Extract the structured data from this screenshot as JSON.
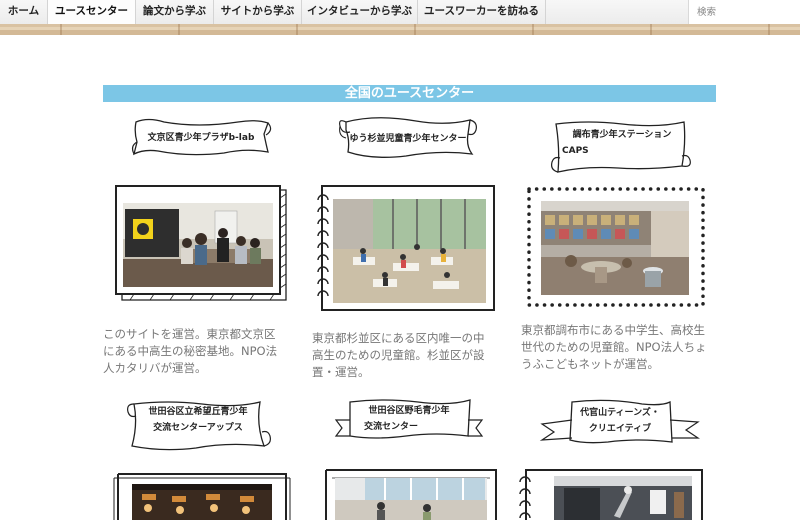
{
  "nav": {
    "items": [
      {
        "label": "ホーム"
      },
      {
        "label": "ユースセンター"
      },
      {
        "label": "論文から学ぶ"
      },
      {
        "label": "サイトから学ぶ"
      },
      {
        "label": "インタビューから学ぶ"
      },
      {
        "label": "ユースワーカーを訪ねる"
      }
    ],
    "active_index": 1,
    "search_placeholder": "検索"
  },
  "section": {
    "title": "全国のユースセンター"
  },
  "centers": [
    {
      "name": "文京区青少年プラザb-lab",
      "description": "このサイトを運営。東京都文京区にある中高生の秘密基地。NPO法人カタリバが運営。"
    },
    {
      "name": "ゆう杉並児童青少年センター",
      "description": "東京都杉並区にある区内唯一の中高生のための児童館。杉並区が設置・運営。"
    },
    {
      "name_lines": [
        "調布青少年ステーション",
        "CAPS"
      ],
      "description": "東京都調布市にある中学生、高校生世代のための児童館。NPO法人ちょうふこどもネットが運営。"
    },
    {
      "name_lines": [
        "世田谷区立希望丘青少年",
        "交流センターアップス"
      ]
    },
    {
      "name_lines": [
        "世田谷区野毛青少年",
        "交流センター"
      ]
    },
    {
      "name_lines": [
        "代官山ティーンズ・",
        "クリエイティブ"
      ]
    }
  ]
}
